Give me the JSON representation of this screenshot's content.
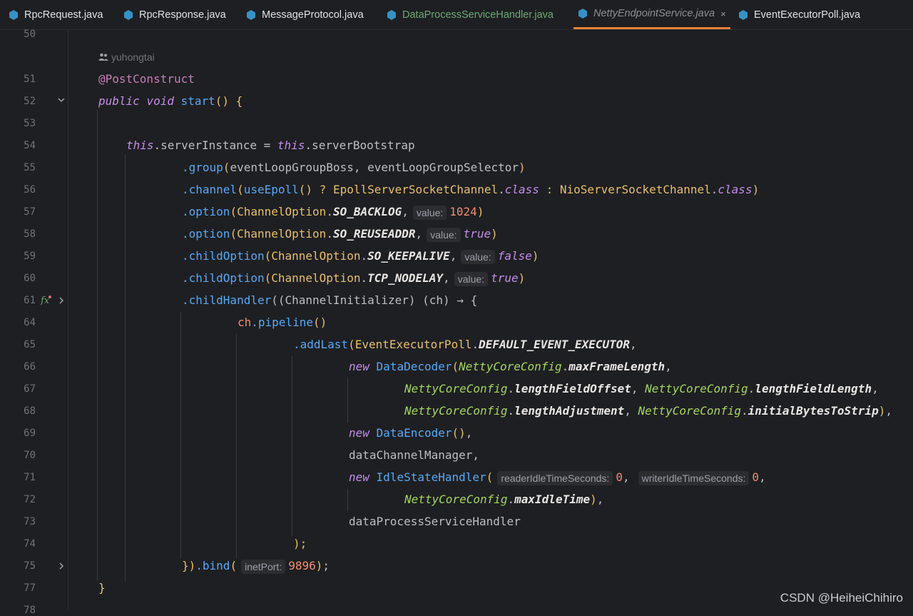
{
  "tabs": [
    {
      "label": "RpcRequest.java",
      "color": "#dfe1e5",
      "active": false
    },
    {
      "label": "RpcResponse.java",
      "color": "#dfe1e5",
      "active": false
    },
    {
      "label": "MessageProtocol.java",
      "color": "#dfe1e5",
      "active": false
    },
    {
      "label": "DataProcessServiceHandler.java",
      "color": "#6aab73",
      "active": false
    },
    {
      "label": "NettyEndpointService.java",
      "color": "#8b8e94",
      "active": true
    },
    {
      "label": "EventExecutorPoll.java",
      "color": "#dfe1e5",
      "active": false
    }
  ],
  "close_glyph": "×",
  "author": "yuhongtai",
  "line_numbers": [
    "50",
    "51",
    "52",
    "53",
    "54",
    "55",
    "56",
    "57",
    "58",
    "59",
    "60",
    "61",
    "64",
    "65",
    "66",
    "67",
    "68",
    "69",
    "70",
    "71",
    "72",
    "73",
    "74",
    "75",
    "77",
    "78"
  ],
  "code": {
    "l51_ann": "@PostConstruct",
    "l52_public": "public",
    "l52_void": "void",
    "l52_name": "start",
    "l52_rest": "() {",
    "this": "this",
    "l54_a": ".serverInstance = ",
    "l54_b": ".serverBootstrap",
    "l55_m": ".group",
    "l55_args": "eventLoopGroupBoss, eventLoopGroupSelector",
    "l56_m": ".channel",
    "l56_fn": "useEpoll",
    "l56_q": "() ? ",
    "l56_c1": "EpollServerSocketChannel",
    "l56_class": "class",
    "l56_colon": " : ",
    "l56_c2": "NioServerSocketChannel",
    "l57_m": ".option",
    "channel_option": "ChannelOption",
    "l57_const": "SO_BACKLOG",
    "hint_value": "value:",
    "l57_val": "1024",
    "l58_const": "SO_REUSEADDR",
    "l58_val": "true",
    "l59_m": ".childOption",
    "l59_const": "SO_KEEPALIVE",
    "l59_val": "false",
    "l60_const": "TCP_NODELAY",
    "l60_val": "true",
    "l61_m": ".childHandler",
    "l61_rest": "((ChannelInitializer) (ch) → {",
    "l64_ch": "ch",
    "l64_m": ".pipeline",
    "l65_m": ".addLast",
    "l65_cls": "EventExecutorPoll",
    "l65_const": "DEFAULT_EVENT_EXECUTOR",
    "new": "new",
    "l66_cls": "DataDecoder",
    "netty_cfg": "NettyCoreConfig",
    "l66_f": "maxFrameLength",
    "l67_f1": "lengthFieldOffset",
    "l67_f2": "lengthFieldLength",
    "l68_f1": "lengthAdjustment",
    "l68_f2": "initialBytesToStrip",
    "l69_cls": "DataEncoder",
    "l70": "dataChannelManager,",
    "l71_cls": "IdleStateHandler",
    "l71_h1": "readerIdleTimeSeconds:",
    "l71_h2": "writerIdleTimeSeconds:",
    "zero": "0",
    "l72_f": "maxIdleTime",
    "l73": "dataProcessServiceHandler",
    "l74": ");",
    "l75_m": ".bind",
    "l75_hint": "inetPort:",
    "l75_val": "9896",
    "l77": "}"
  },
  "watermark": "CSDN @HeiheiChihiro"
}
